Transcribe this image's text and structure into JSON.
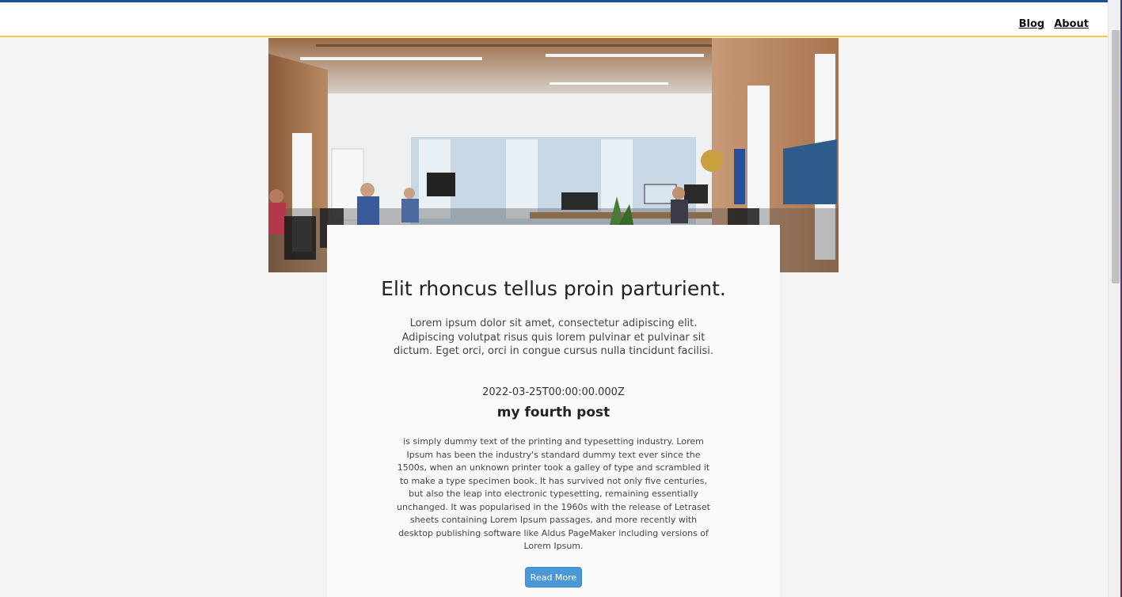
{
  "nav": {
    "links": [
      {
        "label": "Blog"
      },
      {
        "label": "About"
      }
    ]
  },
  "hero": {
    "image": "office-workspace-photo"
  },
  "intro": {
    "title": "Elit rhoncus tellus proin parturient.",
    "description": "Lorem ipsum dolor sit amet, consectetur adipiscing elit. Adipiscing volutpat risus quis lorem pulvinar et pulvinar sit dictum. Eget orci, orci in congue cursus nulla tincidunt facilisi."
  },
  "post": {
    "date": "2022-03-25T00:00:00.000Z",
    "title": "my fourth post",
    "excerpt": "is simply dummy text of the printing and typesetting industry. Lorem Ipsum has been the industry's standard dummy text ever since the 1500s, when an unknown printer took a galley of type and scrambled it to make a type specimen book. It has survived not only five centuries, but also the leap into electronic typesetting, remaining essentially unchanged. It was popularised in the 1960s with the release of Letraset sheets containing Lorem Ipsum passages, and more recently with desktop publishing software like Aldus PageMaker including versions of Lorem Ipsum.",
    "button_label": "Read More"
  },
  "colors": {
    "header_accent": "#1d4f9a",
    "header_border": "#f3c94f",
    "button": "#4a98d8"
  }
}
